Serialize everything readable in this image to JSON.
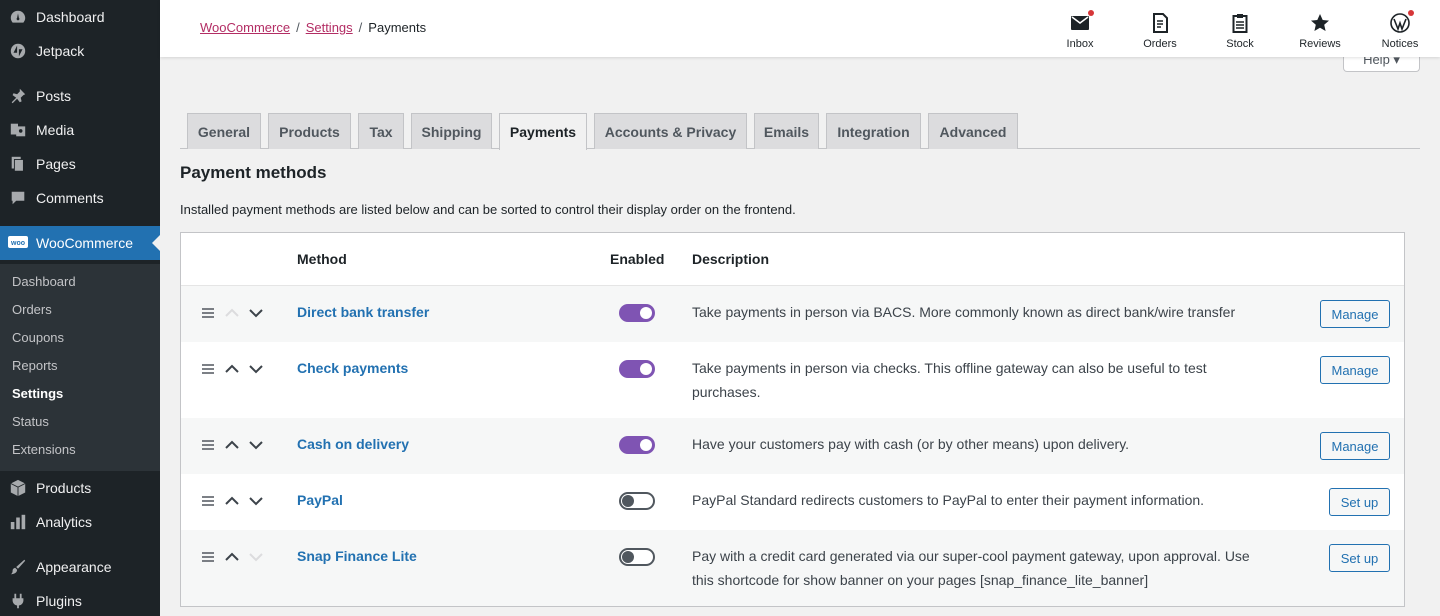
{
  "sidebar": {
    "items": [
      {
        "label": "Dashboard",
        "icon": "dashboard-icon"
      },
      {
        "label": "Jetpack",
        "icon": "jetpack-icon"
      },
      {
        "label": "Posts",
        "icon": "pin-icon"
      },
      {
        "label": "Media",
        "icon": "media-icon"
      },
      {
        "label": "Pages",
        "icon": "pages-icon"
      },
      {
        "label": "Comments",
        "icon": "comments-icon"
      },
      {
        "label": "WooCommerce",
        "icon": "woo-icon"
      },
      {
        "label": "Products",
        "icon": "box-icon"
      },
      {
        "label": "Analytics",
        "icon": "bar-chart-icon"
      },
      {
        "label": "Appearance",
        "icon": "brush-icon"
      },
      {
        "label": "Plugins",
        "icon": "plug-icon"
      }
    ],
    "submenu": [
      "Dashboard",
      "Orders",
      "Coupons",
      "Reports",
      "Settings",
      "Status",
      "Extensions"
    ],
    "current_submenu": "Settings"
  },
  "header": {
    "breadcrumb": {
      "root": "WooCommerce",
      "parent": "Settings",
      "current": "Payments",
      "separator": "/"
    },
    "items": [
      {
        "label": "Inbox",
        "icon": "inbox-icon",
        "badge": true
      },
      {
        "label": "Orders",
        "icon": "orders-icon",
        "badge": false
      },
      {
        "label": "Stock",
        "icon": "stock-icon",
        "badge": false
      },
      {
        "label": "Reviews",
        "icon": "star-icon",
        "badge": false
      },
      {
        "label": "Notices",
        "icon": "wordpress-icon",
        "badge": true
      }
    ],
    "help_label": "Help ▾"
  },
  "tabs": [
    "General",
    "Products",
    "Tax",
    "Shipping",
    "Payments",
    "Accounts & Privacy",
    "Emails",
    "Integration",
    "Advanced"
  ],
  "active_tab": "Payments",
  "section": {
    "title": "Payment methods",
    "intro": "Installed payment methods are listed below and can be sorted to control their display order on the frontend."
  },
  "table": {
    "columns": {
      "method": "Method",
      "enabled": "Enabled",
      "description": "Description"
    },
    "rows": [
      {
        "name": "Direct bank transfer",
        "enabled": true,
        "desc1": "Take payments in person via BACS. More commonly known as direct bank/wire transfer",
        "desc2": "",
        "action": "Manage",
        "up_disabled": true,
        "down_disabled": false
      },
      {
        "name": "Check payments",
        "enabled": true,
        "desc1": "Take payments in person via checks. This offline gateway can also be useful to test",
        "desc2": "purchases.",
        "action": "Manage",
        "up_disabled": false,
        "down_disabled": false
      },
      {
        "name": "Cash on delivery",
        "enabled": true,
        "desc1": "Have your customers pay with cash (or by other means) upon delivery.",
        "desc2": "",
        "action": "Manage",
        "up_disabled": false,
        "down_disabled": false
      },
      {
        "name": "PayPal",
        "enabled": false,
        "desc1": "PayPal Standard redirects customers to PayPal to enter their payment information.",
        "desc2": "",
        "action": "Set up",
        "up_disabled": false,
        "down_disabled": false
      },
      {
        "name": "Snap Finance Lite",
        "enabled": false,
        "desc1": "Pay with a credit card generated via our super-cool payment gateway, upon approval. Use",
        "desc2": "this shortcode for show banner on your pages [snap_finance_lite_banner]",
        "action": "Set up",
        "up_disabled": false,
        "down_disabled": true
      }
    ]
  },
  "colors": {
    "accent": "#2271b1",
    "toggle_on": "#7f54b3",
    "woo": "#b32d64",
    "sidebar_bg": "#1d2327"
  }
}
